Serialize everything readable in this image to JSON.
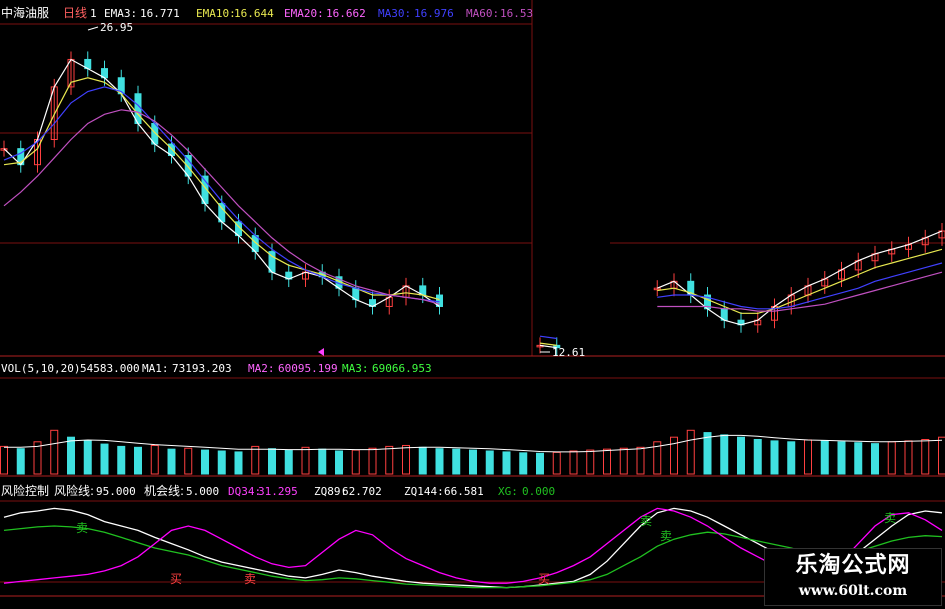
{
  "header": {
    "stock_name": "中海油服",
    "period": "日线",
    "field_index": "1",
    "ema3_label": "EMA3:",
    "ema3_value": "16.771",
    "ema10_label": "EMA10:",
    "ema10_value": "16.644",
    "ema20_label": "EMA20:",
    "ema20_value": "16.662",
    "ma30_label": "MA30:",
    "ma30_value": "16.976",
    "ma60_label": "MA60:",
    "ma60_value": "16.53"
  },
  "price_panel": {
    "high_marker": "26.95",
    "low_marker": "12.61"
  },
  "volume_panel": {
    "label": "VOL(5,10,20)",
    "vol_value": "54583.000",
    "ma1_label": "MA1:",
    "ma1_value": "73193.203",
    "ma2_label": "MA2:",
    "ma2_value": "60095.199",
    "ma3_label": "MA3:",
    "ma3_value": "69066.953"
  },
  "indicator_panel": {
    "name": "风险控制",
    "risk_line_label": "风险线:",
    "risk_line_value": "95.000",
    "chance_line_label": "机会线:",
    "chance_line_value": "5.000",
    "dq34_label": "DQ34:",
    "dq34_value": "31.295",
    "zq89_label": "ZQ89:",
    "zq89_value": "62.702",
    "zq144_label": "ZQ144:",
    "zq144_value": "66.581",
    "xg_label": "XG:",
    "xg_value": "0.000",
    "signals": [
      "卖",
      "买",
      "卖",
      "买",
      "卖",
      "卖",
      "卖"
    ]
  },
  "watermark": {
    "title": "乐淘公式网",
    "url": "www.60lt.com"
  },
  "chart_data": {
    "type": "line",
    "colors": {
      "ema3": "#ffffff",
      "ema10": "#e8e850",
      "ema20": "#ff66ff",
      "ma30": "#4040ff",
      "ma60": "#c050c0",
      "up": "#ff4040",
      "down": "#40e0e0",
      "dq34": "#ffffff",
      "zq89": "#ffff00",
      "zq144": "#ff00ff",
      "xg": "#20c020"
    },
    "price_ylim": [
      12.61,
      26.95
    ],
    "overlay_series": [
      {
        "name": "EMA3",
        "values": [
          21.5,
          20.8,
          21.9,
          24.2,
          25.4,
          25.0,
          24.6,
          23.9,
          22.6,
          21.7,
          21.2,
          20.3,
          19.1,
          18.3,
          17.7,
          17.0,
          16.1,
          15.8,
          16.1,
          15.9,
          15.4,
          14.9,
          14.6,
          15.0,
          15.5,
          15.1,
          14.6,
          null,
          null,
          null,
          null,
          null,
          12.9,
          12.8,
          null,
          null,
          null,
          null,
          null,
          15.4,
          15.7,
          15.1,
          14.5,
          14.0,
          13.8,
          14.0,
          14.6,
          15.1,
          15.5,
          15.8,
          16.2,
          16.6,
          16.9,
          17.1,
          17.3,
          17.6,
          17.9
        ]
      },
      {
        "name": "EMA10",
        "values": [
          20.8,
          20.9,
          21.5,
          23.0,
          24.4,
          24.6,
          24.4,
          23.9,
          23.0,
          22.2,
          21.5,
          20.7,
          19.8,
          18.9,
          18.1,
          17.4,
          16.8,
          16.4,
          16.2,
          16.0,
          15.7,
          15.4,
          15.1,
          15.1,
          15.2,
          15.1,
          14.9,
          null,
          null,
          null,
          null,
          null,
          13.0,
          12.9,
          null,
          null,
          null,
          null,
          null,
          15.3,
          15.4,
          15.2,
          14.9,
          14.6,
          14.3,
          14.3,
          14.5,
          14.8,
          15.1,
          15.4,
          15.7,
          16.0,
          16.3,
          16.5,
          16.7,
          16.9,
          17.1
        ]
      },
      {
        "name": "MA30",
        "values": [
          21.0,
          21.3,
          21.8,
          22.6,
          23.5,
          24.0,
          24.2,
          24.0,
          23.4,
          22.6,
          21.8,
          21.0,
          20.1,
          19.2,
          18.4,
          17.7,
          17.1,
          16.6,
          16.2,
          15.9,
          15.6,
          15.4,
          15.2,
          15.1,
          15.0,
          14.9,
          14.8,
          null,
          null,
          null,
          null,
          null,
          13.3,
          13.2,
          null,
          null,
          null,
          null,
          null,
          15.0,
          15.1,
          15.1,
          15.0,
          14.8,
          14.6,
          14.5,
          14.5,
          14.6,
          14.8,
          15.0,
          15.2,
          15.4,
          15.7,
          15.9,
          16.1,
          16.3,
          16.5
        ]
      },
      {
        "name": "MA60",
        "values": [
          19.0,
          19.6,
          20.3,
          21.1,
          21.9,
          22.6,
          23.0,
          23.2,
          23.1,
          22.7,
          22.1,
          21.4,
          20.6,
          19.8,
          19.0,
          18.3,
          17.6,
          17.0,
          16.5,
          16.1,
          15.8,
          15.5,
          15.3,
          15.1,
          15.0,
          14.9,
          14.7,
          null,
          null,
          null,
          null,
          null,
          null,
          null,
          null,
          null,
          null,
          null,
          null,
          14.6,
          14.6,
          14.6,
          14.6,
          14.5,
          14.5,
          14.4,
          14.4,
          14.5,
          14.6,
          14.7,
          14.9,
          15.1,
          15.3,
          15.5,
          15.7,
          15.9,
          16.1
        ]
      }
    ],
    "volume_ylim": [
      0,
      200000
    ],
    "volume_series": [
      {
        "name": "VOL",
        "values": [
          60000,
          55000,
          70000,
          95000,
          80000,
          72000,
          65000,
          60000,
          58000,
          62000,
          54000,
          56000,
          52000,
          50000,
          48000,
          60000,
          55000,
          52000,
          58000,
          54000,
          50000,
          52000,
          56000,
          60000,
          62000,
          58000,
          55000,
          54000,
          52000,
          50000,
          48000,
          46000,
          45000,
          47000,
          50000,
          52000,
          54000,
          56000,
          58000,
          70000,
          80000,
          95000,
          90000,
          85000,
          80000,
          75000,
          72000,
          70000,
          74000,
          72000,
          70000,
          68000,
          66000,
          70000,
          72000,
          75000,
          80000
        ]
      },
      {
        "name": "MA1",
        "values": [
          58000,
          58000,
          60000,
          66000,
          72000,
          74000,
          73000,
          70000,
          67000,
          64000,
          62000,
          60000,
          58000,
          56000,
          54000,
          54000,
          54000,
          53000,
          53000,
          54000,
          54000,
          53000,
          53000,
          55000,
          57000,
          58000,
          58000,
          57000,
          56000,
          55000,
          53000,
          51000,
          49000,
          48000,
          48000,
          49000,
          51000,
          53000,
          55000,
          60000,
          66000,
          74000,
          80000,
          84000,
          84000,
          82000,
          79000,
          76000,
          74000,
          73000,
          72000,
          71000,
          70000,
          70000,
          71000,
          72000,
          73193
        ]
      }
    ],
    "indicator_ylim": [
      0,
      100
    ],
    "indicator_series": [
      {
        "name": "DQ34",
        "values": [
          85,
          90,
          92,
          95,
          93,
          88,
          80,
          75,
          70,
          62,
          55,
          48,
          40,
          34,
          30,
          26,
          22,
          18,
          16,
          20,
          25,
          22,
          18,
          15,
          12,
          10,
          9,
          8,
          7,
          6,
          5,
          6,
          8,
          10,
          12,
          20,
          35,
          55,
          75,
          90,
          95,
          92,
          85,
          75,
          65,
          55,
          45,
          35,
          25,
          20,
          30,
          45,
          60,
          75,
          88,
          92,
          90
        ]
      },
      {
        "name": "ZQ89",
        "values": [
          70,
          72,
          74,
          75,
          74,
          72,
          68,
          62,
          56,
          50,
          46,
          42,
          36,
          30,
          26,
          22,
          18,
          15,
          13,
          14,
          16,
          15,
          13,
          11,
          9,
          8,
          7,
          6,
          5,
          5,
          5,
          6,
          7,
          9,
          11,
          14,
          20,
          30,
          40,
          52,
          60,
          65,
          68,
          66,
          62,
          58,
          54,
          50,
          44,
          40,
          42,
          46,
          52,
          58,
          62,
          64,
          63
        ]
      },
      {
        "name": "ZQ144",
        "values": [
          10,
          12,
          14,
          16,
          18,
          20,
          24,
          30,
          40,
          55,
          70,
          75,
          70,
          60,
          50,
          40,
          32,
          28,
          30,
          45,
          60,
          70,
          65,
          50,
          38,
          30,
          22,
          16,
          12,
          10,
          10,
          12,
          16,
          22,
          30,
          40,
          55,
          70,
          85,
          95,
          92,
          85,
          75,
          62,
          50,
          40,
          30,
          20,
          14,
          20,
          35,
          55,
          75,
          88,
          90,
          82,
          70
        ]
      }
    ]
  }
}
